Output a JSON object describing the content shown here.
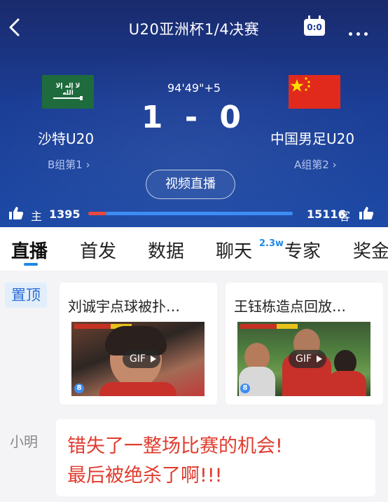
{
  "header": {
    "title": "U20亚洲杯1/4决赛",
    "score_icon_text": "0:0"
  },
  "match": {
    "clock": "94'49\"+5",
    "score": "1 - 0",
    "home": {
      "name": "沙特U20",
      "rank": "B组第1",
      "flag_text": "لا إله إلا الله"
    },
    "away": {
      "name": "中国男足U20",
      "rank": "A组第2"
    },
    "video_button": "视频直播"
  },
  "support": {
    "home_label": "主",
    "home_count": "1395",
    "away_label": "客",
    "away_count": "15116",
    "home_share": 0.084
  },
  "tabs": [
    {
      "label": "直播",
      "active": true
    },
    {
      "label": "首发"
    },
    {
      "label": "数据"
    },
    {
      "label": "聊天",
      "badge": "2.3w"
    },
    {
      "label": "专家"
    },
    {
      "label": "奖金"
    }
  ],
  "feed": {
    "pinned_label": "置顶",
    "cards": [
      {
        "title": "刘诚宇点球被扑…",
        "badge": "GIF"
      },
      {
        "title": "王钰栋造点回放…",
        "badge": "GIF"
      }
    ],
    "comment": {
      "author": "小明",
      "text_line1": "错失了一整场比赛的机会!",
      "text_line2": "最后被绝杀了啊!!!"
    }
  },
  "colors": {
    "header_blue": "#1b3d95",
    "home_bar": "#e8483d",
    "away_bar": "#3d8df5",
    "accent": "#1e88e5",
    "comment_red": "#e03c2e"
  }
}
